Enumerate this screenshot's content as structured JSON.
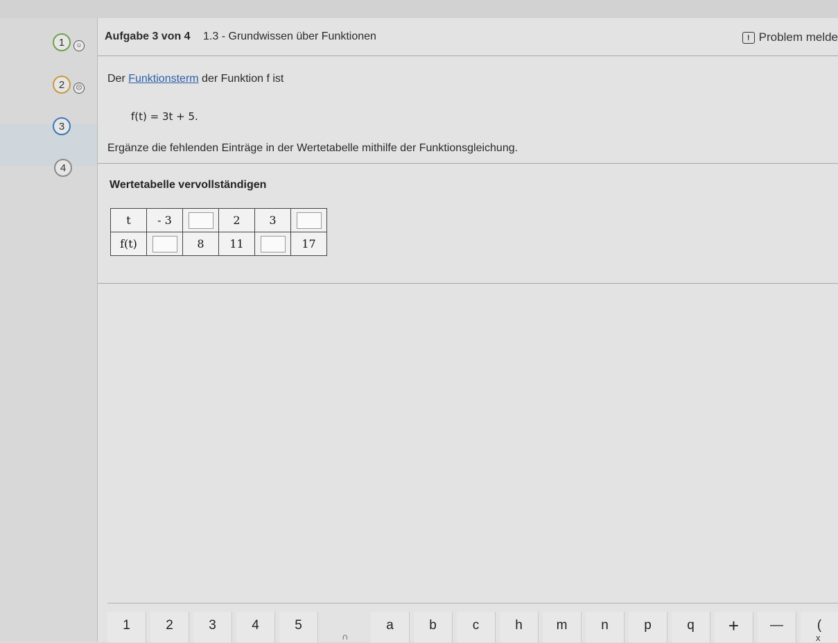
{
  "sidebar": {
    "items": [
      {
        "number": "1",
        "status": "done",
        "smiley": "☺"
      },
      {
        "number": "2",
        "status": "partial",
        "smiley": "☹"
      },
      {
        "number": "3",
        "status": "current",
        "smiley": ""
      },
      {
        "number": "4",
        "status": "open",
        "smiley": ""
      }
    ]
  },
  "header": {
    "task_counter": "Aufgabe 3 von 4",
    "topic": "1.3 - Grundwissen über Funktionen",
    "report_label": "Problem melde",
    "report_icon": "!"
  },
  "task": {
    "intro_prefix": "Der ",
    "intro_link": "Funktionsterm",
    "intro_suffix": " der Funktion f ist",
    "formula": "f(t) = 3t + 5.",
    "instruction": "Ergänze die fehlenden Einträge in der Wertetabelle mithilfe der Funktionsgleichung.",
    "section_title": "Wertetabelle vervollständigen"
  },
  "table": {
    "row_t_label": "t",
    "row_f_label": "f(t)",
    "t_values": [
      "- 3",
      "",
      "2",
      "3",
      ""
    ],
    "f_values": [
      "",
      "8",
      "11",
      "",
      "17"
    ]
  },
  "keyboard": {
    "keys": [
      "1",
      "2",
      "3",
      "4",
      "5",
      "a",
      "b",
      "c",
      "h",
      "m",
      "n",
      "p",
      "q",
      "+",
      "—",
      "("
    ],
    "sub_labels": [
      "∩",
      "x"
    ]
  }
}
